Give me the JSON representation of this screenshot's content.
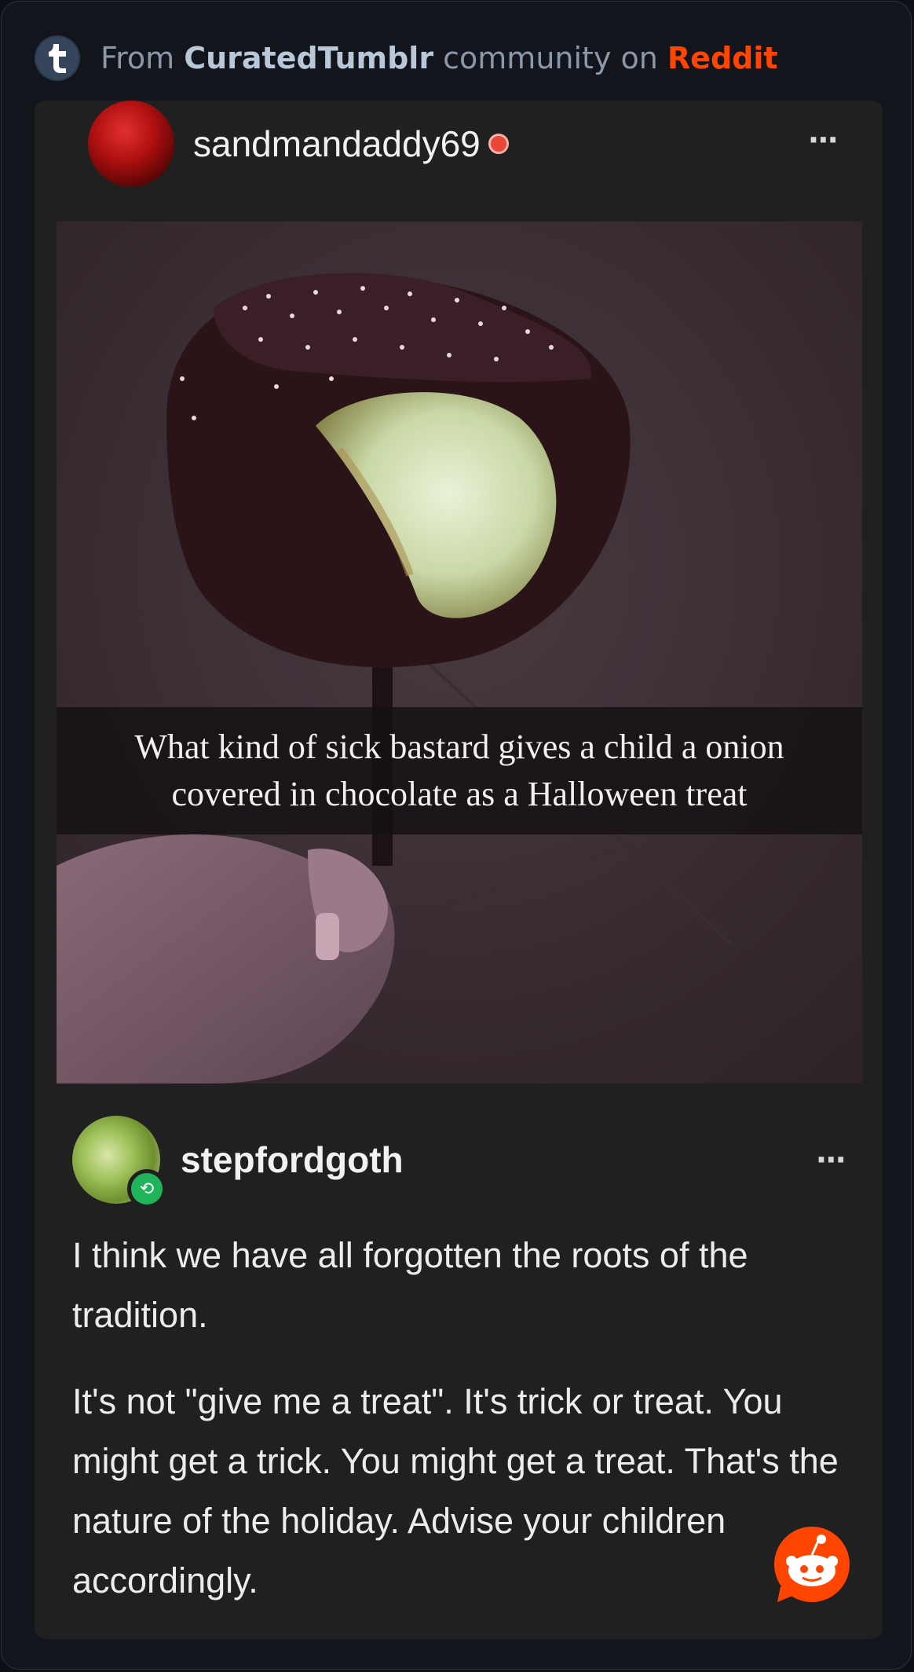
{
  "header": {
    "prefix": "From ",
    "community": "CuratedTumblr",
    "middle": " community on ",
    "platform": "Reddit"
  },
  "post": {
    "username": "sandmandaddy69",
    "menu_label": "···",
    "image_caption_line1": "What kind of sick bastard gives a child a onion",
    "image_caption_line2": "covered in chocolate as a Halloween treat"
  },
  "reply": {
    "username": "stepfordgoth",
    "menu_label": "···",
    "paragraph1": "I think we have all forgotten the roots of the tradition.",
    "paragraph2": "It's not \"give me a treat\". It's trick or treat. You might get a trick. You might get a treat. That's the nature of the holiday. Advise your children accordingly."
  },
  "colors": {
    "reddit_orange": "#ff4500",
    "tumblr_blue": "#35465c",
    "reblog_green": "#1fb35a"
  },
  "icons": {
    "tumblr": "tumblr-icon",
    "reddit": "reddit-snoo-icon",
    "reblog": "reblog-icon"
  }
}
